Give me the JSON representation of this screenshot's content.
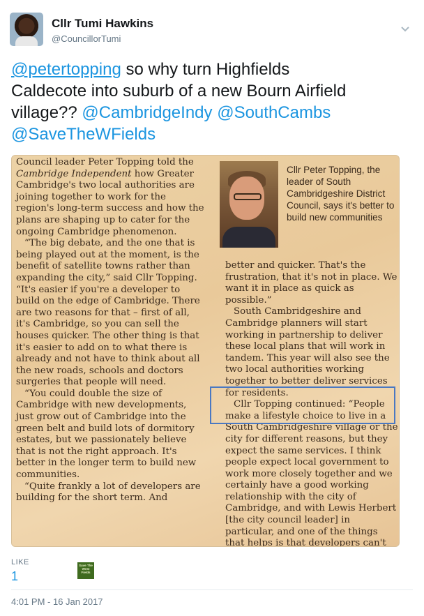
{
  "author": {
    "name": "Cllr Tumi Hawkins",
    "handle": "@CouncillorTumi"
  },
  "tweet": {
    "line1_link": "@petertopping",
    "line1_text": " so why turn Highfields",
    "line2_text": "Caldecote into suburb of a new Bourn Airfield",
    "line3_text": "village?? ",
    "mention1": "@CambridgeIndy",
    "mention2": "@SouthCambs",
    "mention3": "@SaveTheWFields"
  },
  "clipping": {
    "caption": "Cllr Peter Topping, the leader of South Cambridgeshire District Council, says it's better to build new communities",
    "col1_line1": "Council leader Peter Topping told the",
    "col1_paper": "Cambridge Independent",
    "col1_how": " how",
    "col1_rest": "Greater Cambridge's two local authorities are joining together to work for the region's long-term success and how the plans are shaping up to cater for the ongoing Cambridge phenomenon.",
    "col1_p2": "“The big debate, and the one that is being played out at the moment, is the benefit of satellite towns rather than expanding the city,” said Cllr Topping. “It's easier if you're a developer to build on the edge of Cambridge. There are two reasons for that – first of all, it's Cambridge, so you can sell the houses quicker. The other thing is that it's easier to add on to what there is already and not have to think about all the new roads, schools and doctors surgeries that people will need.",
    "col1_p3": "“You could double the size of Cambridge with new developments, just grow out of Cambridge into the green belt and build lots of dormitory estates, but we passionately believe that is not the right approach. It's better in the longer term to build new communities.",
    "col1_p4": "“Quite frankly a lot of developers are building for the short term. And",
    "col2_p1": "better and quicker. That's the frustration, that it's not in place. We want it in place as quick as possible.”",
    "col2_p2": "South Cambridgeshire and Cambridge planners will start working in partnership to deliver these local plans that will work in tandem. This year will also see the two local authorities working together to better deliver services for residents.",
    "col2_p3": "Cllr Topping continued: “People make a lifestyle choice to live in a South Cambridgeshire village or the city for different reasons, but they expect the same services. I think people expect local government to work more closely together and we certainly have a good working relationship with the city of Cambridge, and with Lewis Herbert [the city council leader] in particular, and one of the things that helps is that developers can't play us off"
  },
  "stats": {
    "likes_label": "LIKE",
    "likes_count": "1",
    "liker_badge": "Save The West Fields"
  },
  "timestamp": "4:01 PM - 16 Jan 2017",
  "colors": {
    "link": "#1b95e0",
    "highlight_box": "#4a78c2",
    "paper": "#ecd2a6"
  }
}
